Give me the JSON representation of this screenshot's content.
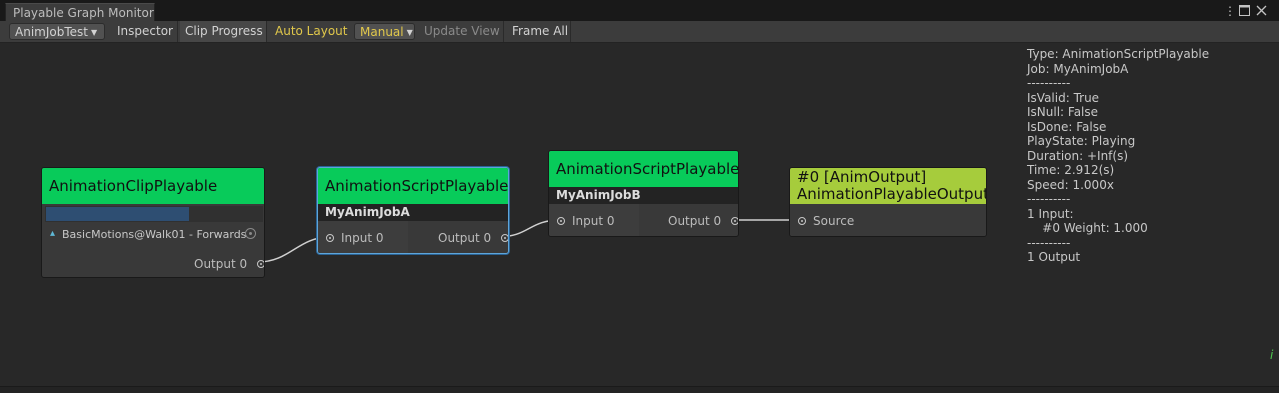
{
  "window": {
    "title": "Playable Graph Monitor",
    "menu_icon": "kebab-menu-icon",
    "maximize_icon": "maximize-icon",
    "close_icon": "close-icon"
  },
  "toolbar": {
    "graph_select": "AnimJobTest",
    "inspector": "Inspector",
    "clip_progress": "Clip Progress",
    "auto_layout": "Auto Layout",
    "layout_mode": "Manual",
    "update_view": "Update View",
    "frame_all": "Frame All"
  },
  "nodes": {
    "clip": {
      "title": "AnimationClipPlayable",
      "progress": 0.66,
      "clip_name": "BasicMotions@Walk01 - Forwards",
      "output": "Output 0"
    },
    "jobA": {
      "title": "AnimationScriptPlayable",
      "subtitle": "MyAnimJobA",
      "input": "Input 0",
      "output": "Output 0"
    },
    "jobB": {
      "title": "AnimationScriptPlayable",
      "subtitle": "MyAnimJobB",
      "input": "Input 0",
      "output": "Output 0"
    },
    "output": {
      "title_line1": "#0 [AnimOutput]",
      "title_line2": "AnimationPlayableOutput",
      "input": "Source"
    }
  },
  "info": [
    "Type: AnimationScriptPlayable",
    "Job: MyAnimJobA",
    "----------",
    "IsValid: True",
    "IsNull: False",
    "IsDone: False",
    "PlayState: Playing",
    "Duration: +Inf(s)",
    "Time: 2.912(s)",
    "Speed: 1.000x",
    "----------",
    "1 Input:",
    "    #0 Weight: 1.000",
    "----------",
    "1 Output"
  ],
  "colors": {
    "node_header": "#08cb5a",
    "output_header": "#a6cc3c",
    "selection": "#5fa5d9",
    "highlight_text": "#e1c84b"
  }
}
